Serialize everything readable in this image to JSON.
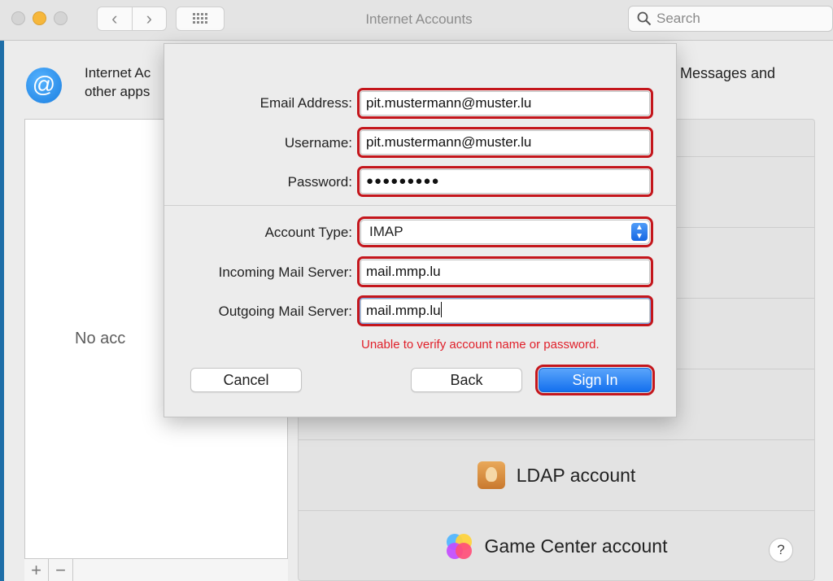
{
  "window": {
    "title": "Internet Accounts"
  },
  "titlebar": {
    "back_glyph": "‹",
    "forward_glyph": "›",
    "search_placeholder": "Search"
  },
  "intro": {
    "line1": "Internet Ac",
    "line2": "other apps",
    "line_right": "Messages and"
  },
  "accounts": {
    "empty_text": "No acc",
    "add_glyph": "+",
    "remove_glyph": "−"
  },
  "providers": [
    {
      "label": "LDAP account",
      "icon": "ldap-contacts-icon"
    },
    {
      "label": "Game Center account",
      "icon": "game-center-icon"
    }
  ],
  "help": {
    "label": "?"
  },
  "sheet": {
    "email": {
      "label": "Email Address:",
      "value": "pit.mustermann@muster.lu"
    },
    "username": {
      "label": "Username:",
      "value": "pit.mustermann@muster.lu"
    },
    "password": {
      "label": "Password:",
      "value": "●●●●●●●●●"
    },
    "account_type": {
      "label": "Account Type:",
      "value": "IMAP"
    },
    "incoming": {
      "label": "Incoming Mail Server:",
      "value": "mail.mmp.lu"
    },
    "outgoing": {
      "label": "Outgoing Mail Server:",
      "value": "mail.mmp.lu"
    },
    "error": "Unable to verify account name or password.",
    "buttons": {
      "cancel": "Cancel",
      "back": "Back",
      "sign_in": "Sign In"
    }
  },
  "colors": {
    "highlight": "#c4161c",
    "error": "#e0202a",
    "accent": "#1470ee"
  }
}
